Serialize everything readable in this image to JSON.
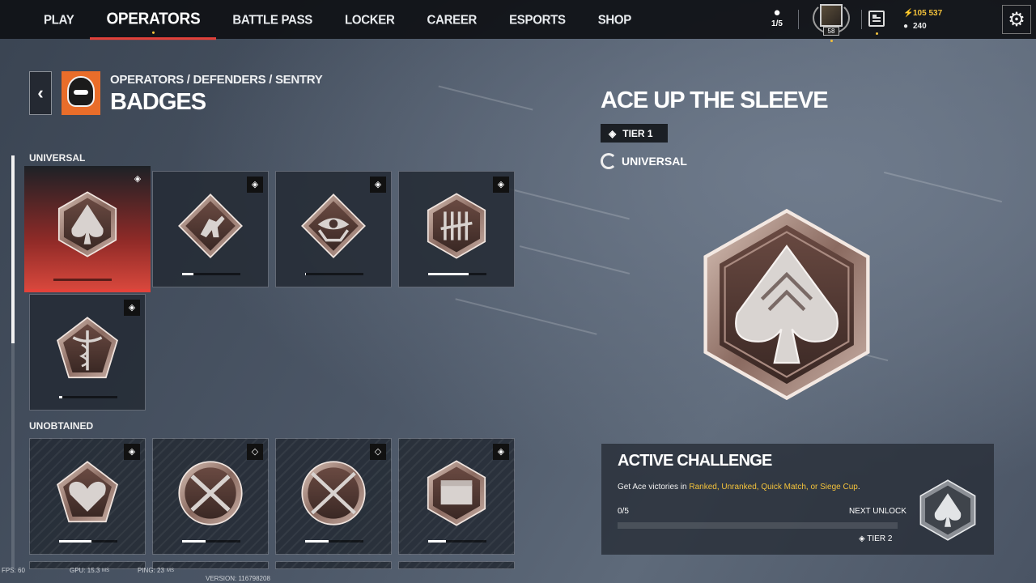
{
  "nav": {
    "items": [
      {
        "label": "PLAY",
        "active": false
      },
      {
        "label": "OPERATORS",
        "active": true
      },
      {
        "label": "BATTLE PASS",
        "active": false
      },
      {
        "label": "LOCKER",
        "active": false
      },
      {
        "label": "CAREER",
        "active": false
      },
      {
        "label": "ESPORTS",
        "active": false
      },
      {
        "label": "SHOP",
        "active": false
      }
    ],
    "squad": "1/5",
    "level": "58",
    "renown": "105 537",
    "credits": "240"
  },
  "header": {
    "breadcrumb": "OPERATORS / DEFENDERS / SENTRY",
    "title": "BADGES"
  },
  "sections": {
    "universal_label": "UNIVERSAL",
    "unobtained_label": "UNOBTAINED"
  },
  "universal_badges": [
    {
      "name": "ace-up-the-sleeve",
      "progress": 0.0,
      "selected": true
    },
    {
      "name": "soldier",
      "progress": 0.2
    },
    {
      "name": "all-seeing-eye",
      "progress": 0.02
    },
    {
      "name": "tally",
      "progress": 0.7
    },
    {
      "name": "caduceus",
      "progress": 0.05
    }
  ],
  "unobtained_badges": [
    {
      "name": "broken-heart",
      "progress": 0.55
    },
    {
      "name": "crossed-smgs",
      "progress": 0.4
    },
    {
      "name": "crossed-rifles",
      "progress": 0.4
    },
    {
      "name": "supply-crate",
      "progress": 0.3
    }
  ],
  "detail": {
    "title": "ACE UP THE SLEEVE",
    "tier": "TIER 1",
    "category": "UNIVERSAL"
  },
  "challenge": {
    "heading": "ACTIVE CHALLENGE",
    "desc_prefix": "Get Ace victories in ",
    "desc_highlight": "Ranked, Unranked, Quick Match, or Siege Cup",
    "desc_suffix": ".",
    "count": "0/5",
    "next_unlock": "NEXT UNLOCK",
    "next_tier": "TIER 2",
    "progress": 0.0
  },
  "footer": {
    "fps": "FPS: 60",
    "gpu": "GPU: 15.3",
    "gpu_unit": "MS",
    "ping": "PING: 23",
    "ping_unit": "MS",
    "version": "VERSION: 116798208"
  },
  "colors": {
    "accent": "#e0413a",
    "highlight": "#f3c23b"
  }
}
